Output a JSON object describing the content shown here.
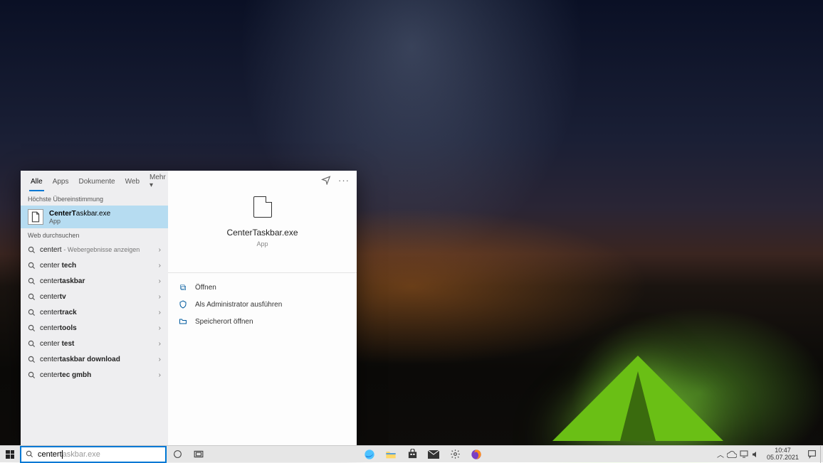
{
  "search": {
    "typed": "centert",
    "hint": "askbar.exe",
    "tabs": [
      "Alle",
      "Apps",
      "Dokumente",
      "Web",
      "Mehr"
    ],
    "activeTab": 0,
    "sectionBest": "Höchste Übereinstimmung",
    "sectionWeb": "Web durchsuchen",
    "best": {
      "prefix": "CenterT",
      "rest": "askbar.exe",
      "sub": "App"
    },
    "webHint": "Webergebnisse anzeigen",
    "web": [
      {
        "plain": "centert",
        "bold": ""
      },
      {
        "plain": "center ",
        "bold": "tech"
      },
      {
        "plain": "center",
        "bold": "taskbar"
      },
      {
        "plain": "center",
        "bold": "tv"
      },
      {
        "plain": "center",
        "bold": "track"
      },
      {
        "plain": "center",
        "bold": "tools"
      },
      {
        "plain": "center ",
        "bold": "test"
      },
      {
        "plain": "center",
        "bold": "taskbar download"
      },
      {
        "plain": "center",
        "bold": "tec gmbh"
      }
    ],
    "preview": {
      "title": "CenterTaskbar.exe",
      "sub": "App"
    },
    "actions": [
      "Öffnen",
      "Als Administrator ausführen",
      "Speicherort öffnen"
    ]
  },
  "taskbar": {
    "apps": [
      "edge",
      "explorer",
      "store",
      "mail",
      "settings",
      "firefox"
    ],
    "clock": {
      "time": "10:47",
      "date": "05.07.2021"
    }
  }
}
